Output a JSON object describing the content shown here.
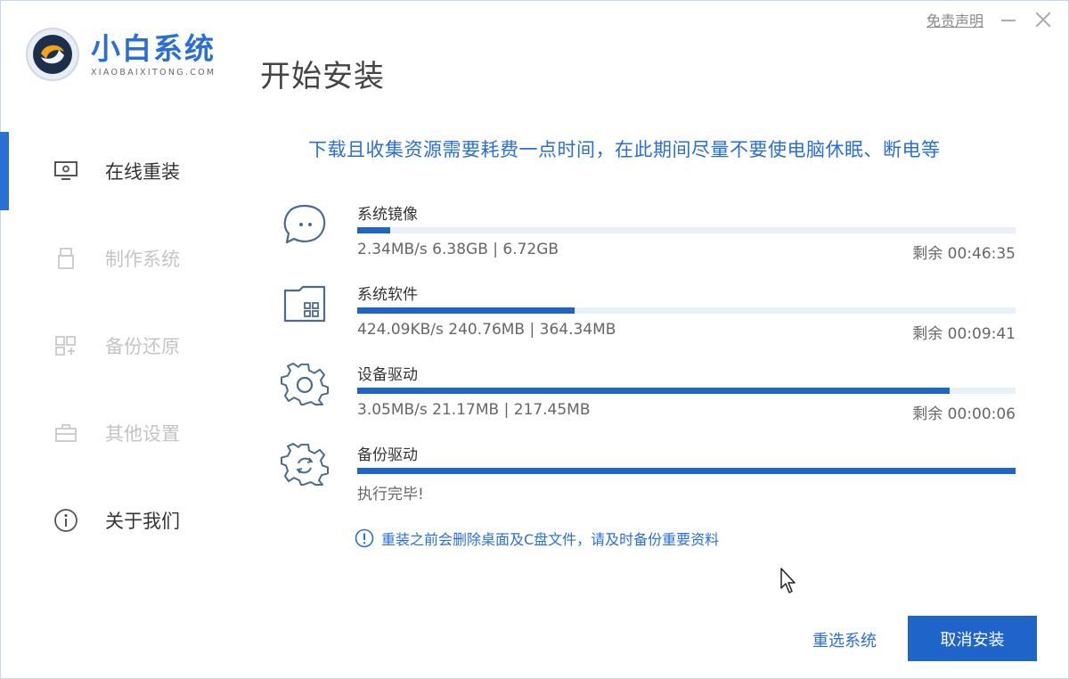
{
  "app": {
    "logo_title": "小白系统",
    "logo_subtitle": "XIAOBAIXITONG.COM",
    "page_title": "开始安装",
    "disclaimer": "免责声明",
    "accent_color": "#1f64c8"
  },
  "sidebar": {
    "items": [
      {
        "label": "在线重装",
        "icon": "monitor-icon",
        "active": true
      },
      {
        "label": "制作系统",
        "icon": "usb-drive-icon",
        "disabled": true
      },
      {
        "label": "备份还原",
        "icon": "backup-grid-icon",
        "disabled": true
      },
      {
        "label": "其他设置",
        "icon": "briefcase-icon",
        "disabled": true
      },
      {
        "label": "关于我们",
        "icon": "info-icon"
      }
    ]
  },
  "main": {
    "notice": "下载且收集资源需要耗费一点时间，在此期间尽量不要使电脑休眠、断电等",
    "tasks": [
      {
        "name": "系统镜像",
        "icon": "chat-bubble-icon",
        "speed": "2.34MB/s 6.38GB | 6.72GB",
        "remaining": "剩余 00:46:35",
        "progress": 0.05
      },
      {
        "name": "系统软件",
        "icon": "folder-apps-icon",
        "speed": "424.09KB/s 240.76MB | 364.34MB",
        "remaining": "剩余 00:09:41",
        "progress": 0.33
      },
      {
        "name": "设备驱动",
        "icon": "gear-icon",
        "speed": "3.05MB/s 21.17MB | 217.45MB",
        "remaining": "剩余 00:00:06",
        "progress": 0.9
      },
      {
        "name": "备份驱动",
        "icon": "gear-refresh-icon",
        "speed": "执行完毕!",
        "remaining": "",
        "progress": 1.0
      }
    ],
    "warning": "重装之前会删除桌面及C盘文件，请及时备份重要资料"
  },
  "footer": {
    "reselect_label": "重选系统",
    "cancel_label": "取消安装"
  }
}
